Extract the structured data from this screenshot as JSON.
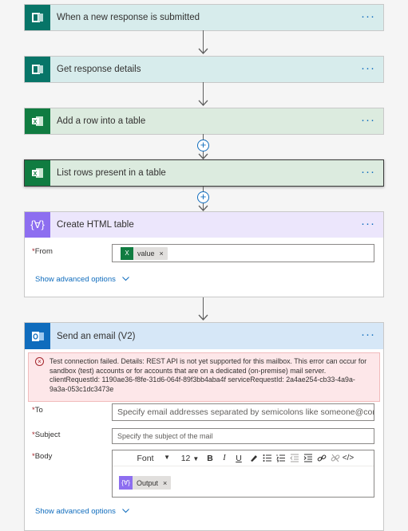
{
  "steps": [
    {
      "title": "When a new response is submitted",
      "menu": "···"
    },
    {
      "title": "Get response details",
      "menu": "···"
    },
    {
      "title": "Add a row into a table",
      "menu": "···"
    },
    {
      "title": "List rows present in a table",
      "menu": "···"
    },
    {
      "title": "Create HTML table",
      "menu": "···"
    },
    {
      "title": "Send an email (V2)",
      "menu": "···"
    }
  ],
  "html_table": {
    "from_label": "From",
    "from_token": "value",
    "advanced": "Show advanced options"
  },
  "email": {
    "error": "Test connection failed. Details: REST API is not yet supported for this mailbox. This error can occur for sandbox (test) accounts or for accounts that are on a dedicated (on-premise) mail server. clientRequestId: 1190ae36-f8fe-31d6-064f-89f3bb4aba4f serviceRequestId: 2a4ae254-cb33-4a9a-9a3a-053c1dc3473e",
    "to_label": "To",
    "to_placeholder": "Specify email addresses separated by semicolons like someone@contoso.com",
    "subject_label": "Subject",
    "subject_placeholder": "Specify the subject of the mail",
    "body_label": "Body",
    "font": "Font",
    "font_size": "12",
    "body_token": "Output",
    "advanced": "Show advanced options"
  },
  "colors": {
    "forms": "#077568",
    "excel": "#107c41",
    "data_operation": "#8d6ef0",
    "outlook": "#0f6cbd",
    "required": "#a4262c"
  },
  "icons": [
    "forms-icon",
    "excel-icon",
    "data-operation-icon",
    "outlook-icon",
    "error-icon",
    "more-icon",
    "add-step-icon",
    "arrow-down-icon"
  ]
}
